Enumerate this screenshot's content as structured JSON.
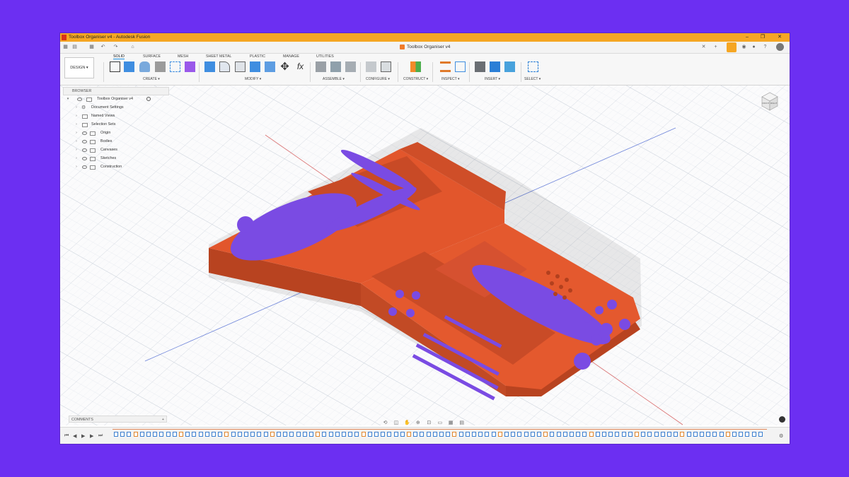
{
  "titlebar": {
    "title": "Toolbox Organiser v4 - Autodesk Fusion"
  },
  "document_tab": {
    "title": "Toolbox Organiser v4"
  },
  "ribbon": {
    "workspace": "DESIGN ▾",
    "tabs": [
      "SOLID",
      "SURFACE",
      "MESH",
      "SHEET METAL",
      "PLASTIC",
      "MANAGE",
      "UTILITIES"
    ],
    "active_tab": "SOLID",
    "groups": [
      "CREATE ▾",
      "MODIFY ▾",
      "ASSEMBLE ▾",
      "CONFIGURE ▾",
      "CONSTRUCT ▾",
      "INSPECT ▾",
      "INSERT ▾",
      "SELECT ▾"
    ]
  },
  "browser": {
    "header": "BROWSER",
    "root": "Toolbox Organiser v4",
    "items": [
      "Document Settings",
      "Named Views",
      "Selection Sets",
      "Origin",
      "Bodies",
      "Canvases",
      "Sketches",
      "Construction"
    ]
  },
  "comments": {
    "label": "COMMENTS",
    "add": "+"
  },
  "viewcube": {
    "front": "FRONT",
    "right": "RIGHT"
  },
  "colors": {
    "model_body": "#e2562c",
    "model_tools": "#7a4be3",
    "window_frame": "#6c2ff2",
    "titlebar": "#f5a623",
    "accent": "#1e8fe1"
  },
  "icons": [
    "app-icon",
    "grid-icon",
    "file-icon",
    "save-icon",
    "undo-icon",
    "redo-icon",
    "home-icon",
    "new-tab-icon",
    "extensions-icon",
    "jobs-icon",
    "notifications-icon",
    "help-icon",
    "avatar-icon",
    "eye-icon",
    "folder-icon",
    "gear-icon",
    "play-icon",
    "settings-icon"
  ]
}
